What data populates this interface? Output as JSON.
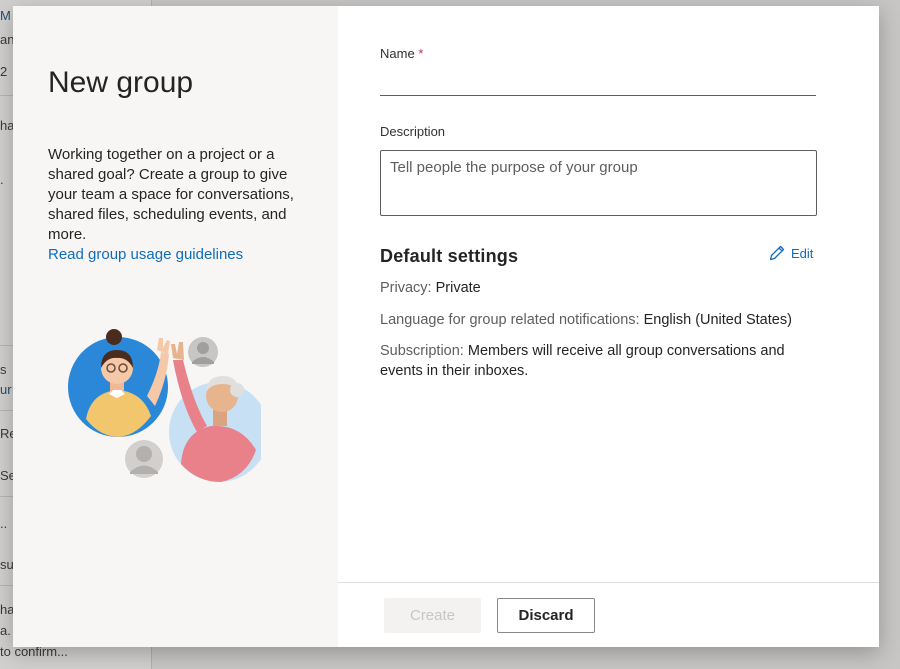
{
  "background": {
    "list_fragments": [
      "M",
      "an",
      "2",
      "hal",
      ".",
      "s",
      "ur",
      "Re",
      "Se",
      "..",
      "su",
      "ha",
      "a.",
      "to confirm..."
    ]
  },
  "dialog": {
    "title": "New group",
    "intro_text": "Working together on a project or a shared goal? Create a group to give your team a space for conversations, shared files, scheduling events, and more.",
    "guidelines_link": "Read group usage guidelines",
    "form": {
      "name_label": "Name",
      "required_marker": "*",
      "name_value": "",
      "description_label": "Description",
      "description_placeholder": "Tell people the purpose of your group",
      "description_value": ""
    },
    "default_settings": {
      "title": "Default settings",
      "edit_label": "Edit",
      "privacy_label": "Privacy:",
      "privacy_value": "Private",
      "language_label": "Language for group related notifications:",
      "language_value": "English (United States)",
      "subscription_label": "Subscription:",
      "subscription_value": "Members will receive all group conversations and events in their inboxes."
    },
    "buttons": {
      "create": "Create",
      "discard": "Discard"
    }
  },
  "colors": {
    "accent": "#0f6cbd",
    "required": "#c4314b",
    "left_pane_bg": "#f7f6f5"
  }
}
